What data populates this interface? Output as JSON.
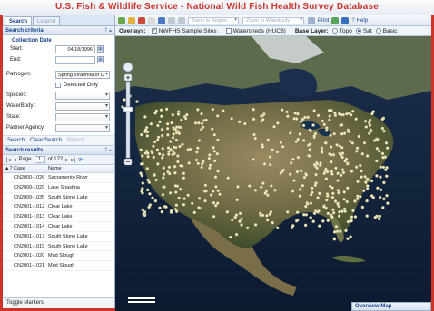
{
  "title": "U.S. Fish & Wildlife Service - National Wild Fish Health Survey Database",
  "tabs": [
    "Search",
    "Legend"
  ],
  "search_criteria": {
    "heading": "Search criteria",
    "tools": "? ▴",
    "collection_date": "Collection Date",
    "start_label": "Start:",
    "start_value": "04/18/1996",
    "end_label": "End:",
    "end_value": "",
    "pathogen_label": "Pathogen:",
    "pathogen_value": "Spring Viraemia of C",
    "detected_only": "Detected Only",
    "species_label": "Species:",
    "waterbody_label": "WaterBody:",
    "state_label": "State:",
    "partner_label": "Partner Agency:",
    "search_button": "Search",
    "clear_button": "Clear Search",
    "report_button": "Report"
  },
  "results": {
    "heading": "Search results",
    "tools": "? ▴",
    "page_label": "Page",
    "page": "1",
    "of_pages": "of 172",
    "columns": [
      "▲?",
      "Case",
      "Name"
    ],
    "rows": [
      {
        "case": "CN2000-1026",
        "name": "Sacramento River"
      },
      {
        "case": "CN2000-1029",
        "name": "Lake Shastina"
      },
      {
        "case": "CN2000-1035",
        "name": "South Stone Lake"
      },
      {
        "case": "CN2001-1012",
        "name": "Clear Lake"
      },
      {
        "case": "CN2001-1013",
        "name": "Clear Lake"
      },
      {
        "case": "CN2001-1014",
        "name": "Clear Lake"
      },
      {
        "case": "CN2001-1017",
        "name": "South Stone Lake"
      },
      {
        "case": "CN2001-1019",
        "name": "South Stone Lake"
      },
      {
        "case": "CN2001-1020",
        "name": "Mud Slough"
      },
      {
        "case": "CN2001-1021",
        "name": "Mud Slough"
      }
    ]
  },
  "toggle_markers": "Toggle Markers",
  "toolbar": {
    "combo1": "Zoom to Region",
    "combo2": "Zoom to Waterbody",
    "print": "Print",
    "help": "Help"
  },
  "overlays": {
    "label": "Overlays:",
    "sample_sites": "NWFHS Sample Sites",
    "watersheds": "Watersheds (HUC8)",
    "base_label": "Base Layer:",
    "topo": "Topo",
    "sat": "Sat",
    "basic": "Basic",
    "selected_base": "Sat"
  },
  "overview_map": "Overview Map",
  "colors": {
    "title_red": "#c9342b",
    "panel_blue": "#15428b",
    "marker": "#f4eec0"
  }
}
